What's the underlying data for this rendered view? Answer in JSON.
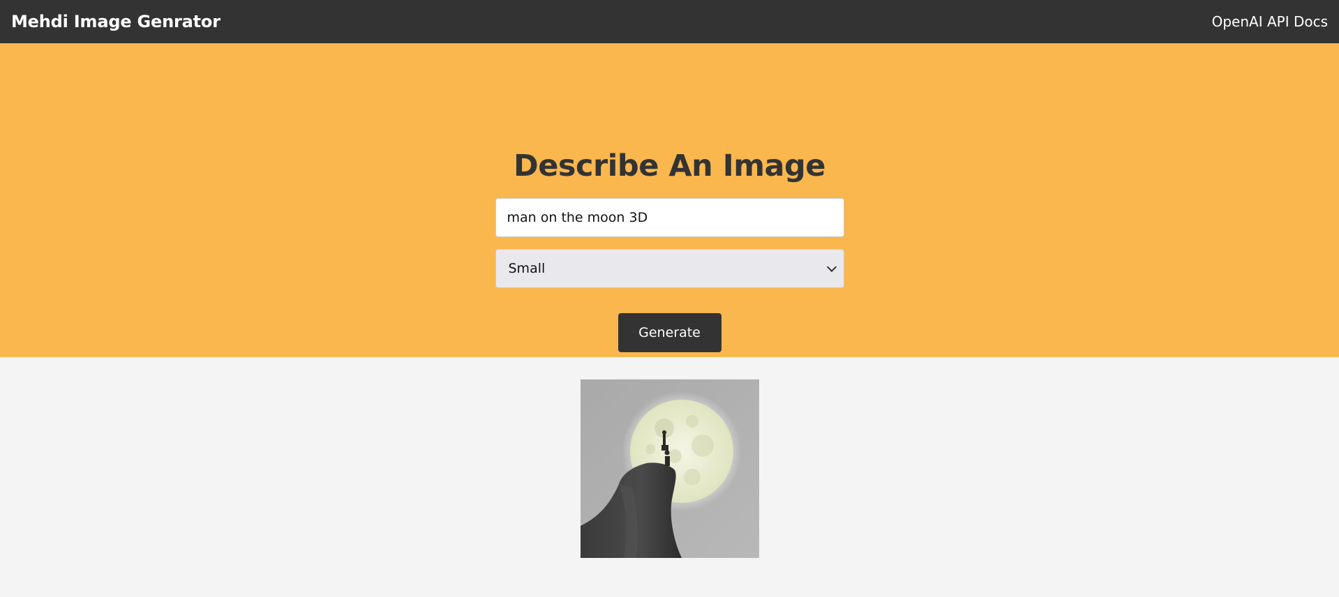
{
  "navbar": {
    "brand": "Mehdi Image Genrator",
    "docs_link": "OpenAI API Docs"
  },
  "hero": {
    "title": "Describe An Image"
  },
  "form": {
    "prompt_value": "man on the moon 3D",
    "size_selected": "Small",
    "generate_label": "Generate"
  },
  "colors": {
    "navbar_bg": "#333333",
    "hero_bg": "#f9b74e",
    "page_bg": "#f4f4f4",
    "button_bg": "#333333"
  },
  "result": {
    "image_subject": "man-on-moon-image"
  }
}
